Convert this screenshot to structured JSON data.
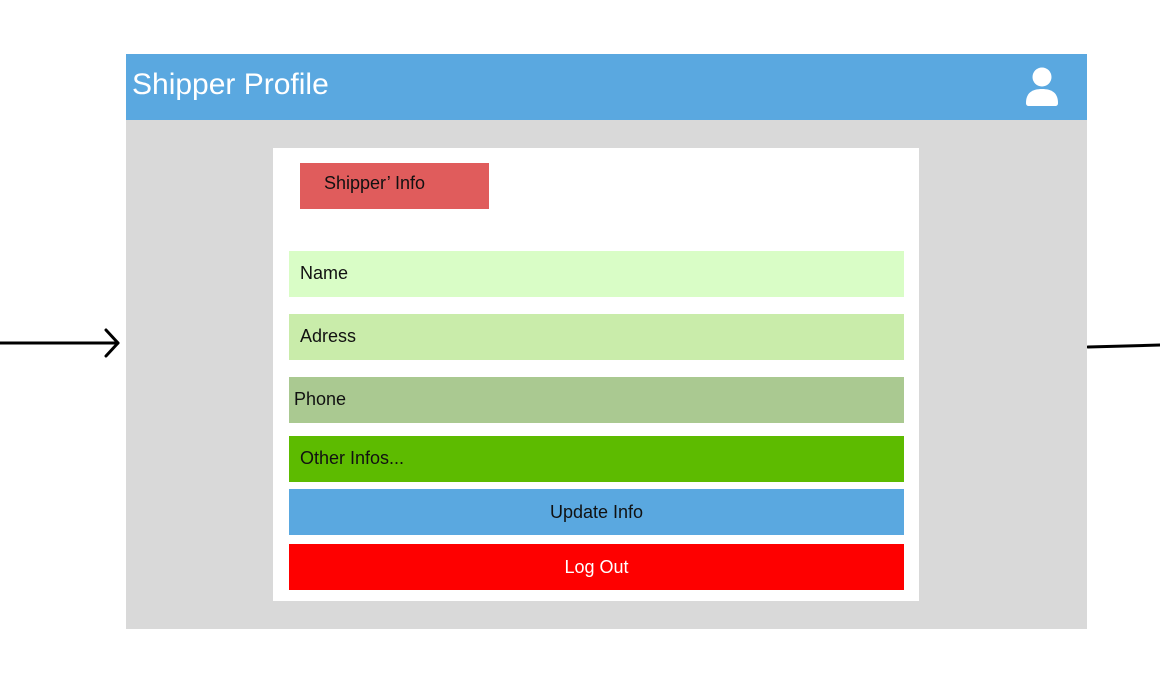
{
  "colors": {
    "header_bg": "#5aa8e0",
    "window_bg": "#d9d9d9",
    "panel_bg": "#ffffff",
    "section_label_bg": "#e05c5c",
    "name_field_bg": "#d9fdc6",
    "adress_field_bg": "#c9ecaa",
    "phone_field_bg": "#aac991",
    "other_field_bg": "#5dbb00",
    "update_button_bg": "#5aa8e0",
    "logout_button_bg": "#fe0000"
  },
  "header": {
    "title": "Shipper Profile",
    "profile_icon": "user-icon"
  },
  "panel": {
    "section_label": "Shipper’ Info",
    "fields": {
      "name": "Name",
      "adress": "Adress",
      "phone": "Phone",
      "other": "Other Infos..."
    },
    "buttons": {
      "update": "Update Info",
      "logout": "Log Out"
    }
  },
  "flow": {
    "incoming_arrow": "arrow-right-icon",
    "outgoing_line": "connector-line"
  }
}
